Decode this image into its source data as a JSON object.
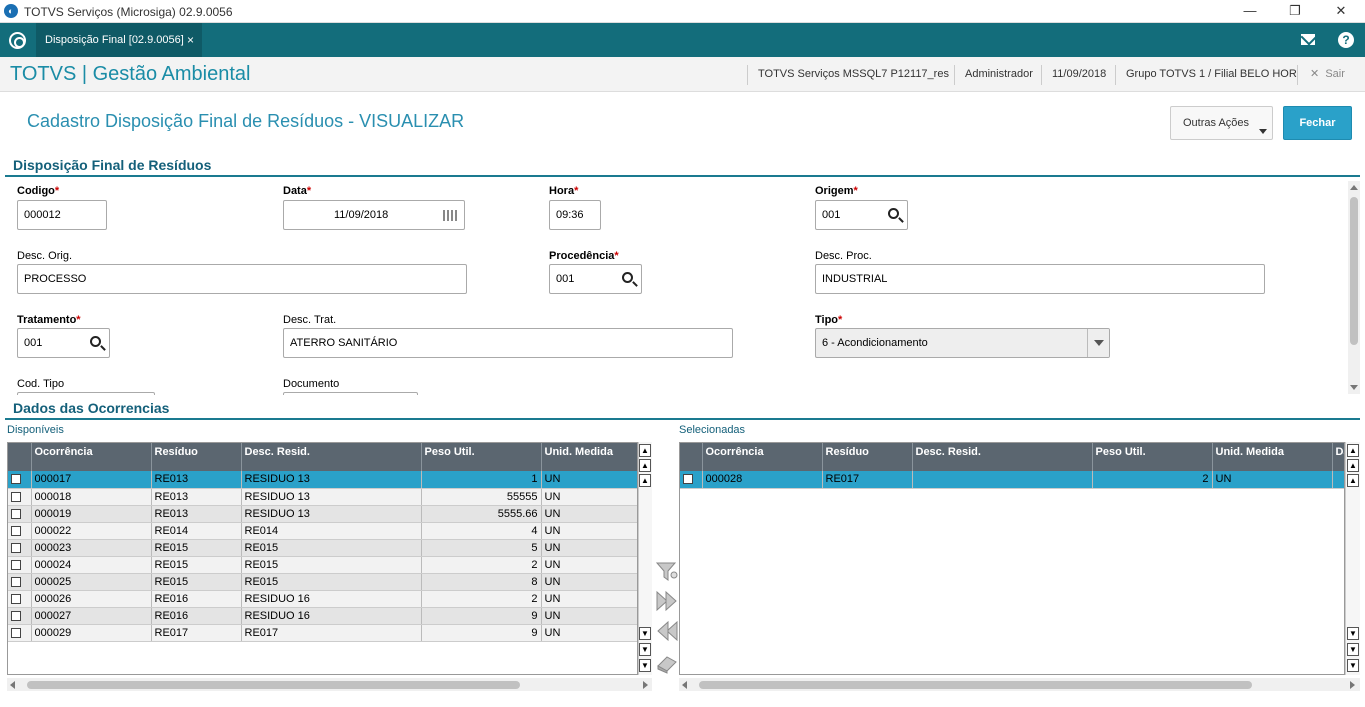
{
  "window": {
    "title": "TOTVS Serviços (Microsiga) 02.9.0056"
  },
  "tab": {
    "label": "Disposição Final [02.9.0056]"
  },
  "header": {
    "brand": "TOTVS | Gestão Ambiental",
    "environment": "TOTVS Serviços MSSQL7 P12117_res",
    "user": "Administrador",
    "date": "11/09/2018",
    "branch": "Grupo TOTVS 1 / Filial BELO HOR",
    "exit": "Sair"
  },
  "page": {
    "title": "Cadastro Disposição Final de Resíduos - VISUALIZAR",
    "actions_label": "Outras Ações",
    "close_label": "Fechar"
  },
  "form": {
    "section_title": "Disposição Final de Resíduos",
    "codigo": {
      "label": "Codigo",
      "value": "000012"
    },
    "data": {
      "label": "Data",
      "value": "11/09/2018"
    },
    "hora": {
      "label": "Hora",
      "value": "09:36"
    },
    "origem": {
      "label": "Origem",
      "value": "001"
    },
    "desc_orig": {
      "label": "Desc. Orig.",
      "value": "PROCESSO"
    },
    "procedencia": {
      "label": "Procedência",
      "value": "001"
    },
    "desc_proc": {
      "label": "Desc. Proc.",
      "value": "INDUSTRIAL"
    },
    "tratamento": {
      "label": "Tratamento",
      "value": "001"
    },
    "desc_trat": {
      "label": "Desc. Trat.",
      "value": "ATERRO SANITÁRIO"
    },
    "tipo": {
      "label": "Tipo",
      "value": "6 - Acondicionamento"
    },
    "cod_tipo": {
      "label": "Cod. Tipo"
    },
    "documento": {
      "label": "Documento"
    }
  },
  "ocorrencias": {
    "section_title": "Dados das Ocorrencias",
    "disponiveis": {
      "label": "Disponíveis",
      "columns": [
        "Ocorrência",
        "Resíduo",
        "Desc. Resid.",
        "Peso Util.",
        "Unid. Medida"
      ],
      "rows": [
        [
          "000017",
          "RE013",
          "RESIDUO 13",
          "1",
          "UN"
        ],
        [
          "000018",
          "RE013",
          "RESIDUO 13",
          "55555",
          "UN"
        ],
        [
          "000019",
          "RE013",
          "RESIDUO 13",
          "5555.66",
          "UN"
        ],
        [
          "000022",
          "RE014",
          "RE014",
          "4",
          "UN"
        ],
        [
          "000023",
          "RE015",
          "RE015",
          "5",
          "UN"
        ],
        [
          "000024",
          "RE015",
          "RE015",
          "2",
          "UN"
        ],
        [
          "000025",
          "RE015",
          "RE015",
          "8",
          "UN"
        ],
        [
          "000026",
          "RE016",
          "RESIDUO 16",
          "2",
          "UN"
        ],
        [
          "000027",
          "RE016",
          "RESIDUO 16",
          "9",
          "UN"
        ],
        [
          "000029",
          "RE017",
          "RE017",
          "9",
          "UN"
        ]
      ]
    },
    "selecionadas": {
      "label": "Selecionadas",
      "columns": [
        "Ocorrência",
        "Resíduo",
        "Desc. Resid.",
        "Peso Util.",
        "Unid. Medida",
        "Da"
      ],
      "rows": [
        [
          "000028",
          "RE017",
          "",
          "2",
          "UN",
          ""
        ]
      ]
    }
  }
}
